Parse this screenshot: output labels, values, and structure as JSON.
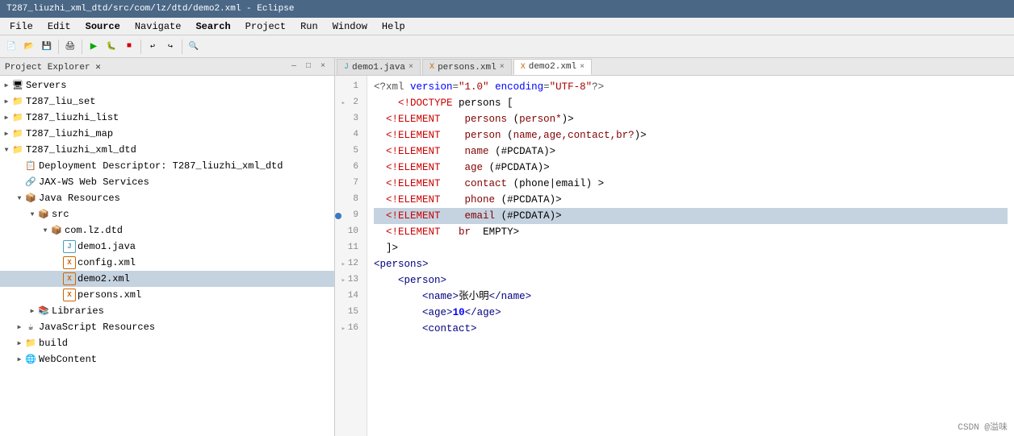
{
  "titleBar": {
    "text": "T287_liuzhi_xml_dtd/src/com/lz/dtd/demo2.xml - Eclipse"
  },
  "menuBar": {
    "items": [
      "File",
      "Edit",
      "Source",
      "Navigate",
      "Search",
      "Project",
      "Run",
      "Window",
      "Help"
    ]
  },
  "leftPanel": {
    "title": "Project Explorer",
    "closeLabel": "×",
    "tree": [
      {
        "level": 0,
        "arrow": "▶",
        "icon": "🖥",
        "label": "Servers",
        "type": "server"
      },
      {
        "level": 0,
        "arrow": "▶",
        "icon": "📁",
        "label": "T287_liu_set",
        "type": "project"
      },
      {
        "level": 0,
        "arrow": "▶",
        "icon": "📁",
        "label": "T287_liuzhi_list",
        "type": "project"
      },
      {
        "level": 0,
        "arrow": "▶",
        "icon": "📁",
        "label": "T287_liuzhi_map",
        "type": "project"
      },
      {
        "level": 0,
        "arrow": "▼",
        "icon": "📁",
        "label": "T287_liuzhi_xml_dtd",
        "type": "project",
        "expanded": true
      },
      {
        "level": 1,
        "arrow": " ",
        "icon": "📋",
        "label": "Deployment Descriptor: T287_liuzhi_xml_dtd",
        "type": "descriptor"
      },
      {
        "level": 1,
        "arrow": " ",
        "icon": "🔗",
        "label": "JAX-WS Web Services",
        "type": "service"
      },
      {
        "level": 1,
        "arrow": "▼",
        "icon": "☕",
        "label": "Java Resources",
        "type": "java",
        "expanded": true
      },
      {
        "level": 2,
        "arrow": "▼",
        "icon": "📦",
        "label": "src",
        "type": "src",
        "expanded": true
      },
      {
        "level": 3,
        "arrow": "▼",
        "icon": "📦",
        "label": "com.lz.dtd",
        "type": "package",
        "expanded": true
      },
      {
        "level": 4,
        "arrow": " ",
        "icon": "J",
        "label": "demo1.java",
        "type": "java-file"
      },
      {
        "level": 4,
        "arrow": " ",
        "icon": "X",
        "label": "config.xml",
        "type": "xml-file"
      },
      {
        "level": 4,
        "arrow": " ",
        "icon": "X",
        "label": "demo2.xml",
        "type": "xml-file",
        "selected": true
      },
      {
        "level": 4,
        "arrow": " ",
        "icon": "X",
        "label": "persons.xml",
        "type": "xml-file"
      },
      {
        "level": 2,
        "arrow": "▶",
        "icon": "📚",
        "label": "Libraries",
        "type": "library"
      },
      {
        "level": 1,
        "arrow": "▶",
        "icon": "☕",
        "label": "JavaScript Resources",
        "type": "js"
      },
      {
        "level": 1,
        "arrow": "▶",
        "icon": "📁",
        "label": "build",
        "type": "folder"
      },
      {
        "level": 1,
        "arrow": "▶",
        "icon": "🌐",
        "label": "WebContent",
        "type": "folder"
      }
    ]
  },
  "tabs": [
    {
      "id": "demo1",
      "label": "demo1.java",
      "type": "java",
      "active": false
    },
    {
      "id": "persons",
      "label": "persons.xml",
      "type": "xml",
      "active": false
    },
    {
      "id": "demo2",
      "label": "demo2.xml",
      "type": "xml",
      "active": true
    }
  ],
  "codeLines": [
    {
      "num": 1,
      "hasMarker": false,
      "hasFold": false,
      "content": "xml_declaration"
    },
    {
      "num": 2,
      "hasMarker": false,
      "hasFold": true,
      "content": "doctype_start"
    },
    {
      "num": 3,
      "hasMarker": false,
      "hasFold": false,
      "content": "element_persons"
    },
    {
      "num": 4,
      "hasMarker": false,
      "hasFold": false,
      "content": "element_person"
    },
    {
      "num": 5,
      "hasMarker": false,
      "hasFold": false,
      "content": "element_name"
    },
    {
      "num": 6,
      "hasMarker": false,
      "hasFold": false,
      "content": "element_age"
    },
    {
      "num": 7,
      "hasMarker": false,
      "hasFold": false,
      "content": "element_contact"
    },
    {
      "num": 8,
      "hasMarker": false,
      "hasFold": false,
      "content": "element_phone"
    },
    {
      "num": 9,
      "hasMarker": true,
      "hasFold": false,
      "content": "element_email",
      "highlighted": true
    },
    {
      "num": 10,
      "hasMarker": false,
      "hasFold": false,
      "content": "element_br"
    },
    {
      "num": 11,
      "hasMarker": false,
      "hasFold": false,
      "content": "doctype_end"
    },
    {
      "num": 12,
      "hasMarker": false,
      "hasFold": true,
      "content": "persons_open"
    },
    {
      "num": 13,
      "hasMarker": false,
      "hasFold": true,
      "content": "person_open"
    },
    {
      "num": 14,
      "hasMarker": false,
      "hasFold": false,
      "content": "name_element"
    },
    {
      "num": 15,
      "hasMarker": false,
      "hasFold": false,
      "content": "age_element"
    },
    {
      "num": 16,
      "hasMarker": false,
      "hasFold": true,
      "content": "contact_open"
    }
  ],
  "statusBar": {
    "watermark": "CSDN @溢味"
  }
}
